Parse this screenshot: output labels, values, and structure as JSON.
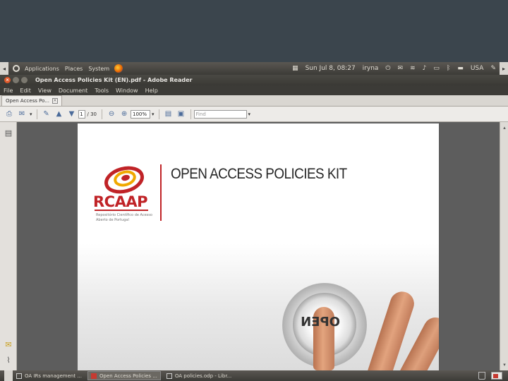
{
  "top_panel": {
    "menus": [
      "Applications",
      "Places",
      "System"
    ],
    "clock": "Sun Jul 8, 08:27",
    "user": "iryna",
    "keyboard_layout": "USA"
  },
  "window": {
    "title": "Open Access Policies Kit (EN).pdf - Adobe Reader"
  },
  "menubar": {
    "items": [
      "File",
      "Edit",
      "View",
      "Document",
      "Tools",
      "Window",
      "Help"
    ]
  },
  "tabs": [
    {
      "label": "Open Access Po..."
    }
  ],
  "toolbar": {
    "current_page": "1",
    "total_pages": "/ 30",
    "zoom": "100%",
    "find_placeholder": "Find"
  },
  "document": {
    "title": "OPEN ACCESS POLICIES KIT",
    "logo_text": "RCAAP",
    "logo_tagline": "Repositório Científico de Acesso Aberto de Portugal",
    "button_word": "OPEN",
    "colors": {
      "brand_red": "#c02327"
    }
  },
  "taskbar": {
    "items": [
      {
        "label": "OA IRs management ..."
      },
      {
        "label": "Open Access Policies ..."
      },
      {
        "label": "OA policies.odp - Libr..."
      }
    ]
  }
}
